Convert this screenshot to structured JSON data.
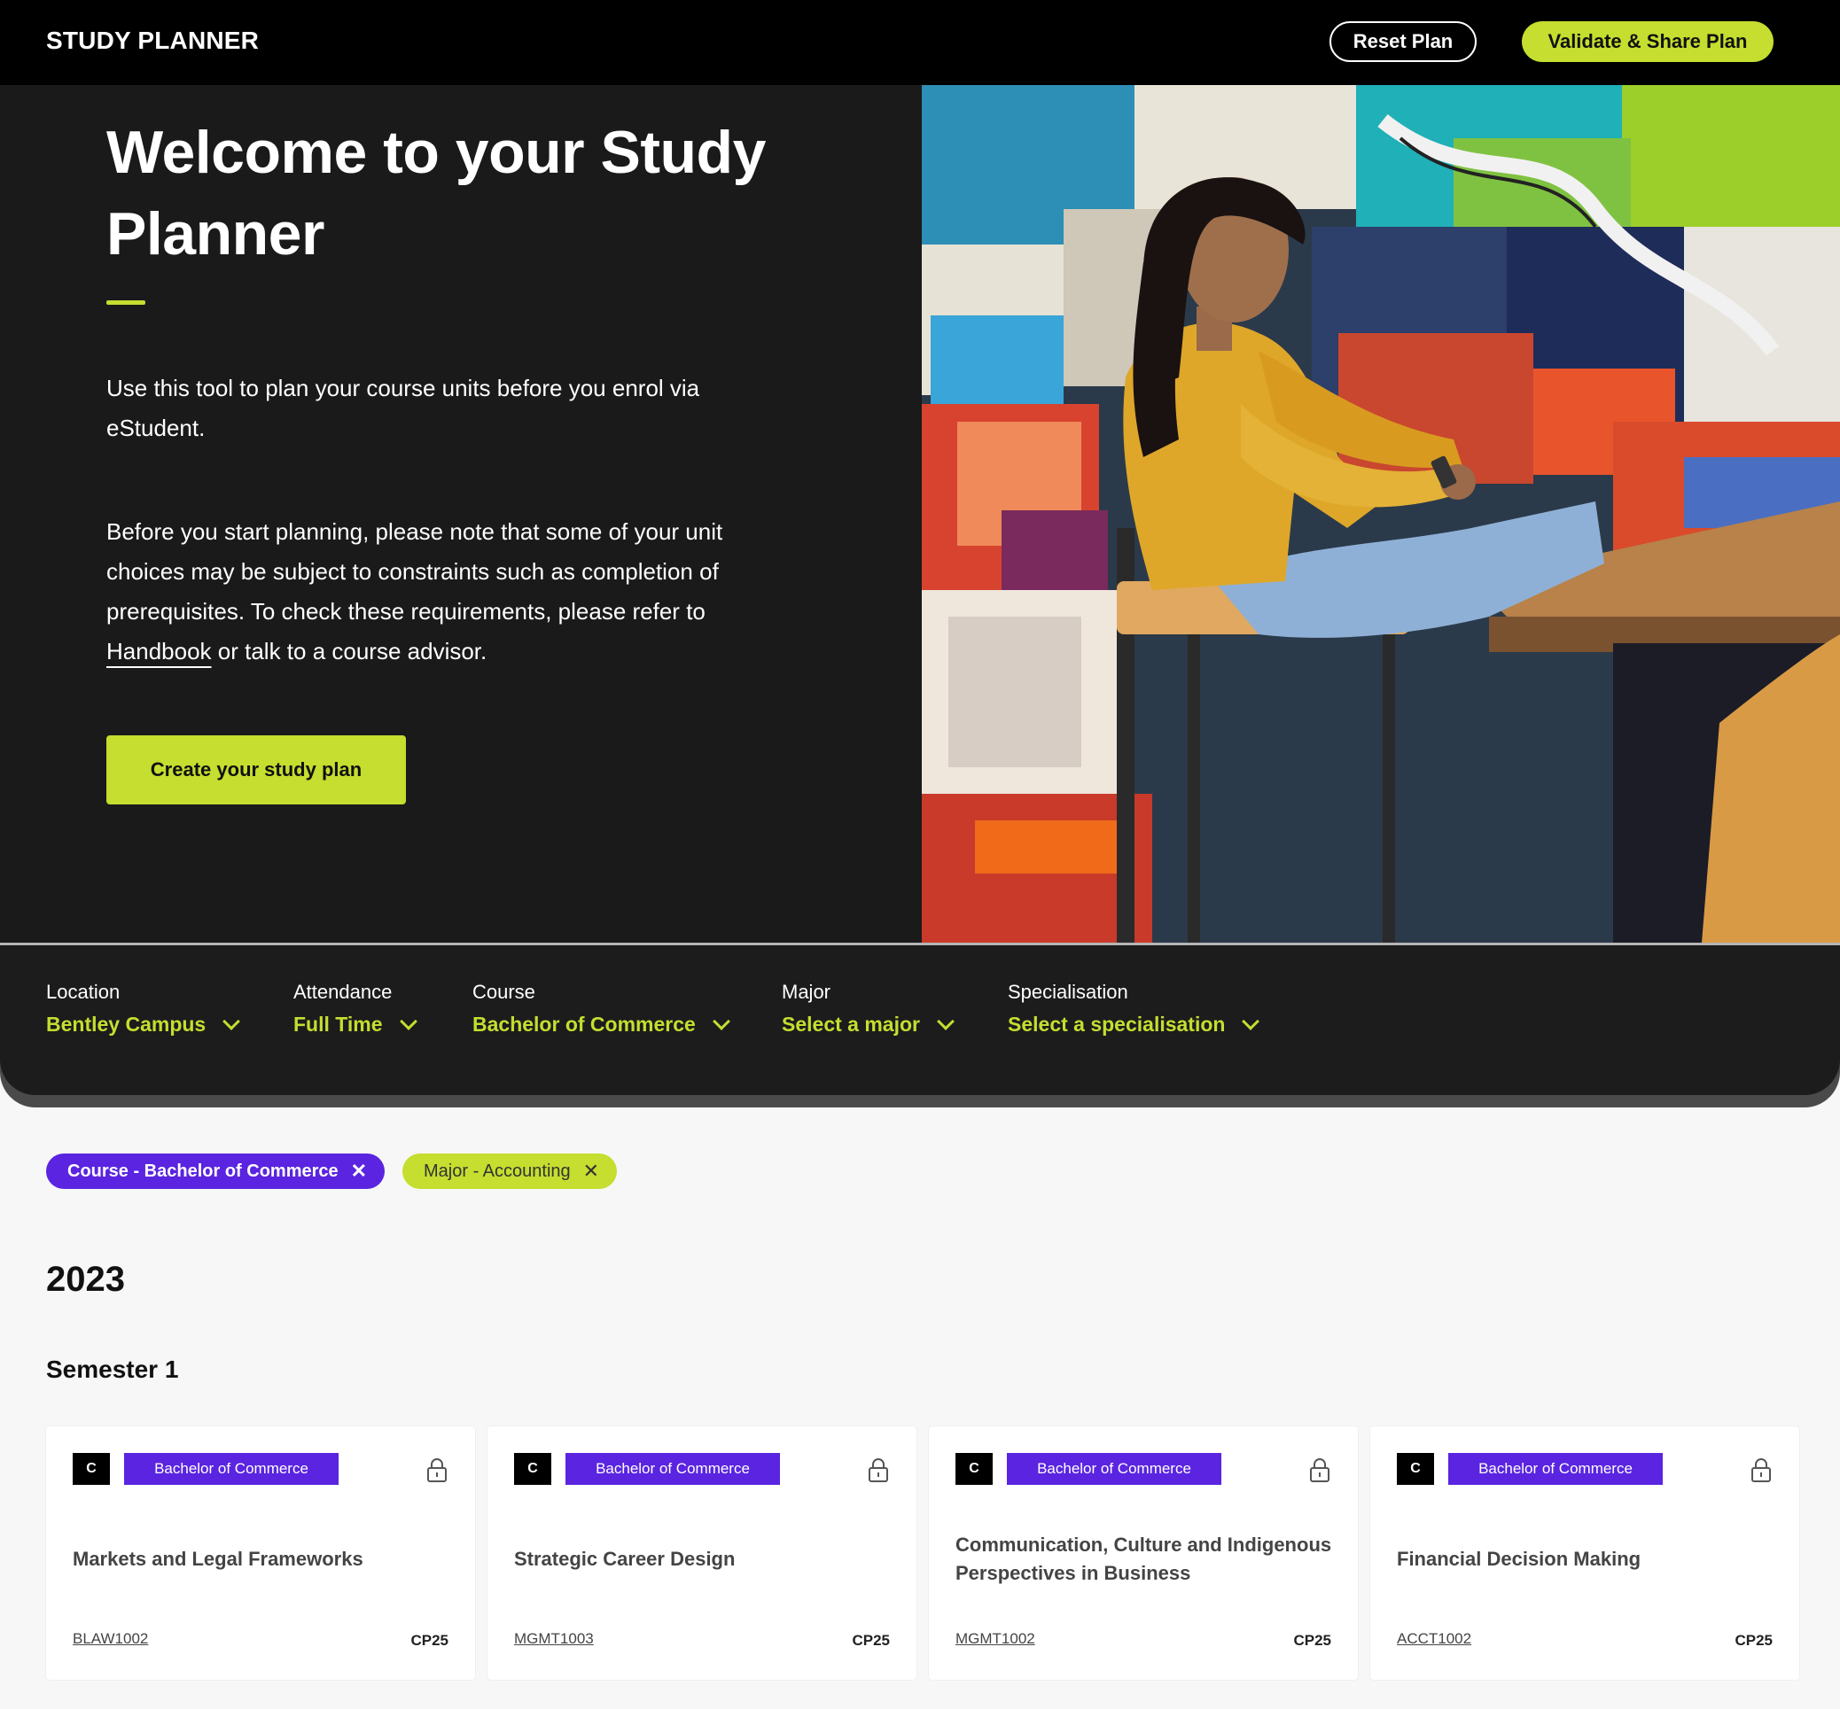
{
  "header": {
    "brand": "STUDY PLANNER",
    "reset_label": "Reset Plan",
    "validate_label": "Validate & Share Plan"
  },
  "hero": {
    "title": "Welcome to your Study Planner",
    "intro": "Use this tool to plan your course units before you enrol via eStudent.",
    "note_before": "Before you start planning, please note that some of your unit choices may be subject to constraints such as completion of prerequisites. To check these requirements, please refer to ",
    "handbook_link": "Handbook",
    "note_after": " or talk to a course advisor.",
    "cta_label": "Create your study plan"
  },
  "filters": [
    {
      "label": "Location",
      "value": "Bentley Campus"
    },
    {
      "label": "Attendance",
      "value": "Full Time"
    },
    {
      "label": "Course",
      "value": "Bachelor of Commerce"
    },
    {
      "label": "Major",
      "value": "Select a major"
    },
    {
      "label": "Specialisation",
      "value": "Select a specialisation"
    }
  ],
  "chips": {
    "course": "Course - Bachelor of Commerce",
    "major": "Major - Accounting",
    "remove_glyph": "✕"
  },
  "plan": {
    "year": "2023",
    "semester": "Semester 1",
    "units": [
      {
        "badge": "C",
        "tag": "Bachelor of Commerce",
        "title": "Markets and Legal Frameworks",
        "code": "BLAW1002",
        "cp": "CP25"
      },
      {
        "badge": "C",
        "tag": "Bachelor of Commerce",
        "title": "Strategic Career Design",
        "code": "MGMT1003",
        "cp": "CP25"
      },
      {
        "badge": "C",
        "tag": "Bachelor of Commerce",
        "title": "Communication, Culture and Indigenous Perspectives in Business",
        "code": "MGMT1002",
        "cp": "CP25"
      },
      {
        "badge": "C",
        "tag": "Bachelor of Commerce",
        "title": "Financial Decision Making",
        "code": "ACCT1002",
        "cp": "CP25"
      }
    ]
  },
  "colors": {
    "accent_lime": "#c5de2f",
    "accent_purple": "#5a24e0",
    "dark": "#1a1a1a"
  },
  "icons": {
    "chevron": "chevron-down-icon",
    "lock": "lock-icon",
    "close": "close-icon"
  }
}
